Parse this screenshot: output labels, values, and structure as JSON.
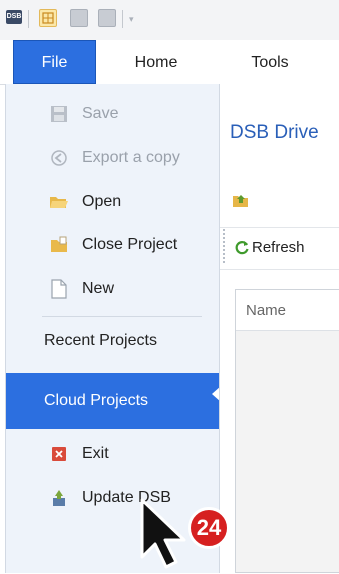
{
  "qat": {
    "logo_text": "DSB"
  },
  "tabs": [
    {
      "label": "File",
      "selected": true
    },
    {
      "label": "Home",
      "selected": false
    },
    {
      "label": "Tools",
      "selected": false
    }
  ],
  "menu": {
    "items": [
      {
        "label": "Save",
        "icon": "save-icon",
        "disabled": true
      },
      {
        "label": "Export a copy",
        "icon": "export-icon",
        "disabled": true
      },
      {
        "label": "Open",
        "icon": "folder-open-icon",
        "disabled": false
      },
      {
        "label": "Close Project",
        "icon": "folder-close-icon",
        "disabled": false
      },
      {
        "label": "New",
        "icon": "new-document-icon",
        "disabled": false
      },
      {
        "label": "Recent Projects"
      },
      {
        "label": "Cloud Projects",
        "selected": true
      },
      {
        "label": "Exit",
        "icon": "exit-icon",
        "disabled": false
      },
      {
        "label": "Update DSB",
        "icon": "update-icon",
        "disabled": false
      }
    ]
  },
  "main": {
    "title": "DSB Drive",
    "refresh_label": "Refresh",
    "list_columns": [
      "Name"
    ]
  },
  "annotation": {
    "step_badge": "24"
  },
  "colors": {
    "accent": "#2c6fe0",
    "title": "#2a5fb8",
    "badge": "#d62020"
  }
}
